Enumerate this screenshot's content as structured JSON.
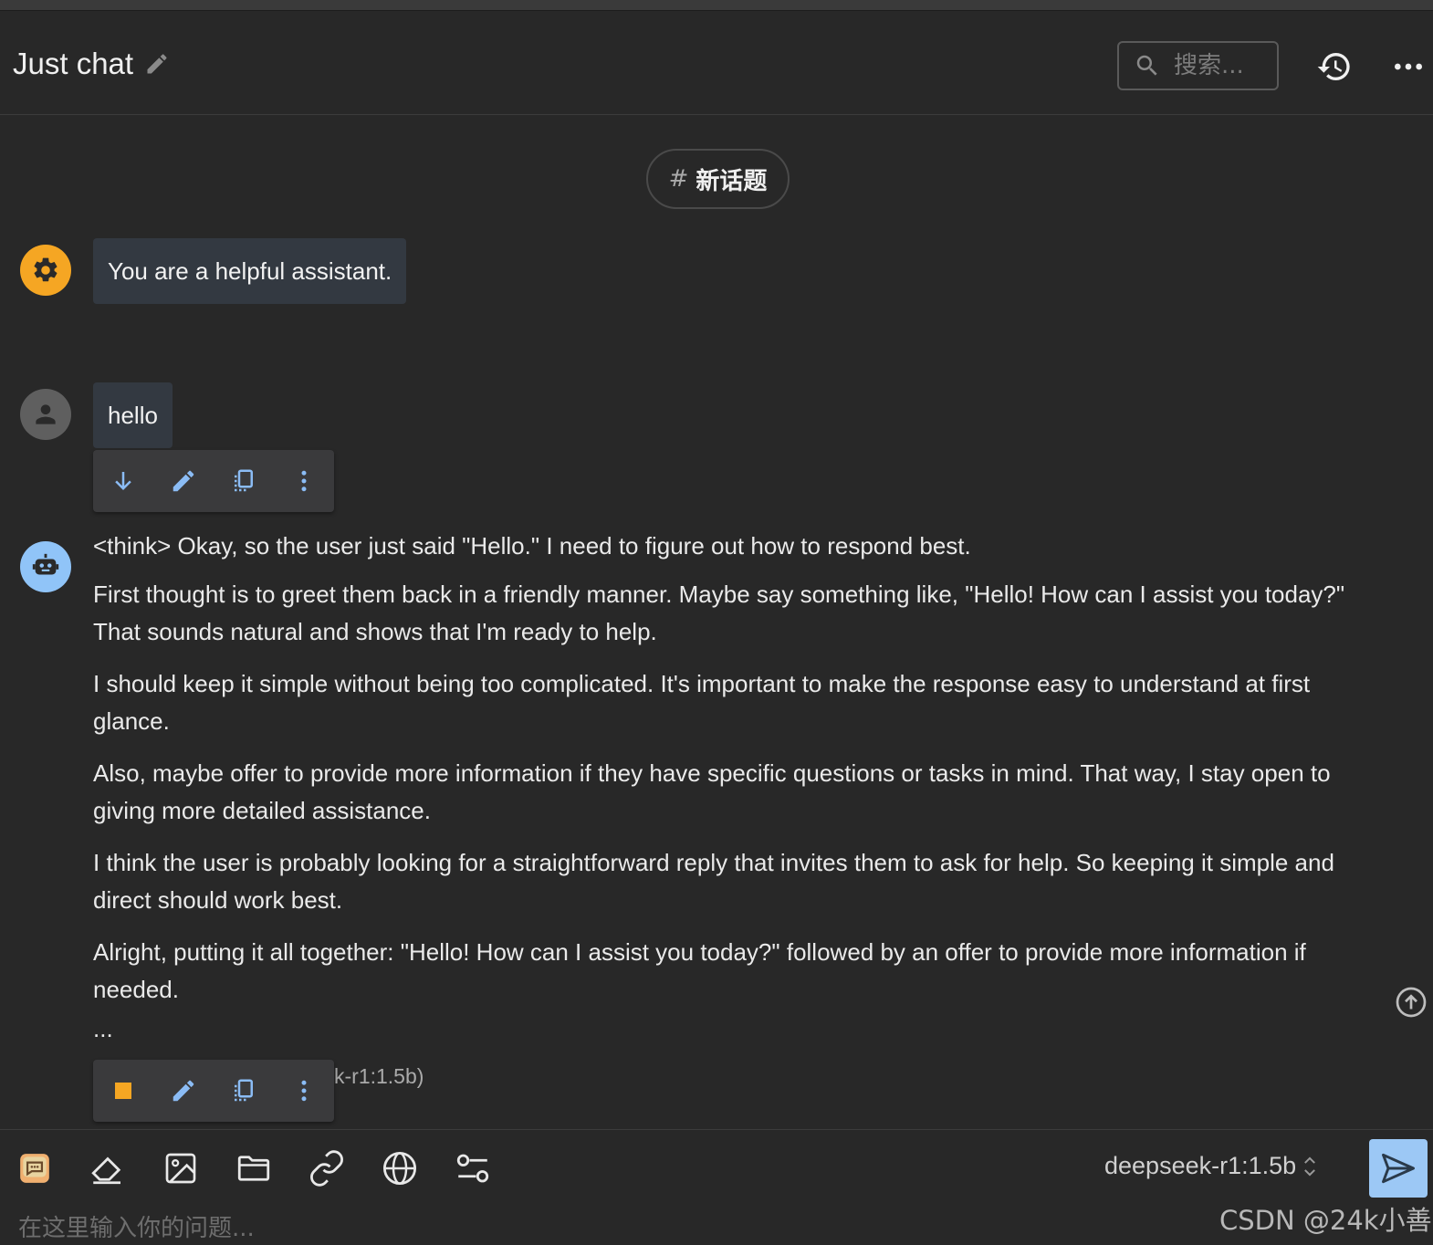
{
  "header": {
    "title": "Just chat",
    "search_placeholder": "搜索..."
  },
  "topic": {
    "hash": "#",
    "label": "新话题"
  },
  "messages": {
    "system": {
      "text": "You are a helpful assistant."
    },
    "user": {
      "text": "hello"
    },
    "assistant": {
      "paragraphs": [
        "<think> Okay, so the user just said \"Hello.\" I need to figure out how to respond best.",
        "First thought is to greet them back in a friendly manner. Maybe say something like, \"Hello! How can I assist you today?\" That sounds natural and shows that I'm ready to help.",
        "I should keep it simple without being too complicated. It's important to make the response easy to understand at first glance.",
        "Also, maybe offer to provide more information if they have specific questions or tasks in mind. That way, I stay open to giving more detailed assistance.",
        "I think the user is probably looking for a straightforward reply that invites them to ask for help. So keeping it simple and direct should work best.",
        "Alright, putting it all together: \"Hello! How can I assist you today?\" followed by an offer to provide more information if needed."
      ],
      "ellipsis": "...",
      "model_tag": "k-r1:1.5b)"
    }
  },
  "input": {
    "model": "deepseek-r1:1.5b",
    "placeholder": "在这里输入你的问题..."
  },
  "watermark": "CSDN @24k小善",
  "colors": {
    "background": "#282828",
    "system_avatar": "#f5a623",
    "user_avatar": "#5f5f5f",
    "bot_avatar": "#90c4f8",
    "icon_blue": "#8bbcf5",
    "stop_orange": "#f5a623",
    "send_button": "#9cc8f5"
  }
}
